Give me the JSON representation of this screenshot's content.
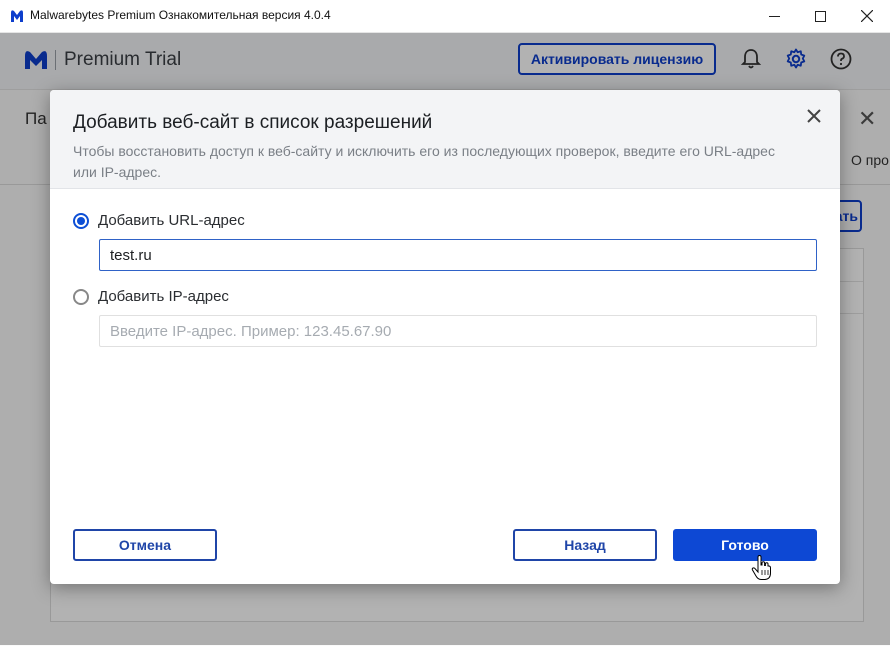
{
  "window": {
    "title": "Malwarebytes Premium Ознакомительная версия  4.0.4"
  },
  "header": {
    "brand_name": "Premium Trial",
    "activate_label": "Активировать лицензию"
  },
  "background": {
    "heading_partial": "Па",
    "tab_partial": "О про",
    "button_partial": "ать"
  },
  "dialog": {
    "title": "Добавить веб-сайт в список разрешений",
    "subtitle": "Чтобы восстановить доступ к веб-сайту и исключить его из последующих проверок, введите его URL-адрес или IP-адрес.",
    "options": {
      "url_label": "Добавить URL-адрес",
      "url_selected": true,
      "url_value": "test.ru",
      "ip_label": "Добавить IP-адрес",
      "ip_selected": false,
      "ip_placeholder": "Введите IP-адрес. Пример: 123.45.67.90"
    },
    "buttons": {
      "cancel": "Отмена",
      "back": "Назад",
      "done": "Готово"
    }
  },
  "colors": {
    "accent": "#0d48d4",
    "brand_blue": "#0d3ecc"
  },
  "icons": [
    "malwarebytes-logo-icon",
    "minimize-icon",
    "maximize-icon",
    "close-icon",
    "bell-icon",
    "gear-icon",
    "help-icon",
    "cursor-hand-icon"
  ]
}
